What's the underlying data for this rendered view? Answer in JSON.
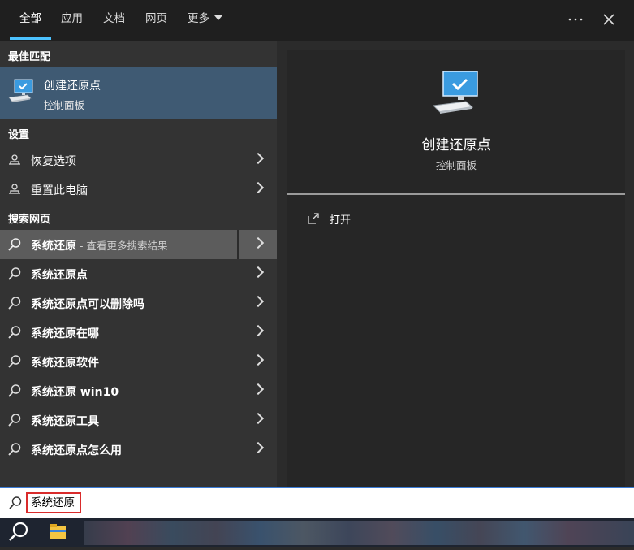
{
  "tabs": [
    {
      "label": "全部",
      "active": true
    },
    {
      "label": "应用",
      "active": false
    },
    {
      "label": "文档",
      "active": false
    },
    {
      "label": "网页",
      "active": false
    },
    {
      "label": "更多",
      "active": false
    }
  ],
  "top_icons": {
    "more": "ellipsis-icon",
    "close": "close-icon"
  },
  "sections": {
    "best_match": "最佳匹配",
    "settings": "设置",
    "web": "搜索网页"
  },
  "best_match": {
    "title": "创建还原点",
    "subtitle": "控制面板",
    "icon": "computer-check-icon"
  },
  "settings_items": [
    {
      "label": "恢复选项",
      "icon": "recovery-icon"
    },
    {
      "label": "重置此电脑",
      "icon": "recovery-icon"
    }
  ],
  "web_items": [
    {
      "bold": "系统还原",
      "suffix": " - 查看更多搜索结果",
      "highlighted": true
    },
    {
      "bold": "系统还原点",
      "suffix": ""
    },
    {
      "bold": "系统还原点可以删除吗",
      "suffix": ""
    },
    {
      "bold": "系统还原在哪",
      "suffix": ""
    },
    {
      "bold": "系统还原软件",
      "suffix": ""
    },
    {
      "bold": "系统还原 win10",
      "suffix": ""
    },
    {
      "bold": "系统还原工具",
      "suffix": ""
    },
    {
      "bold": "系统还原点怎么用",
      "suffix": ""
    }
  ],
  "preview": {
    "title": "创建还原点",
    "subtitle": "控制面板",
    "open_label": "打开"
  },
  "search": {
    "value": "系统还原"
  },
  "colors": {
    "accent": "#4cc2ff",
    "selected_bg": "#3f5a73",
    "highlight_bg": "#5c5c5c",
    "search_outline": "#d92b2b"
  }
}
